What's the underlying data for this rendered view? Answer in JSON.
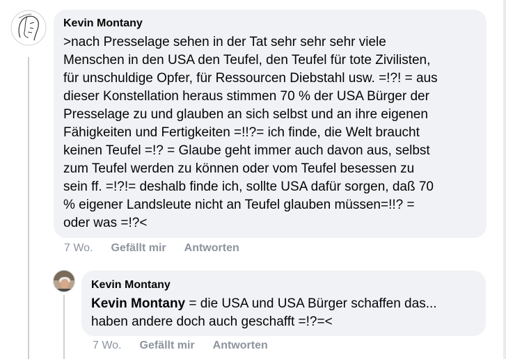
{
  "comments": [
    {
      "author": "Kevin Montany",
      "avatar_icon": "sketch-face-avatar-icon",
      "text_lines": [
        ">nach Presselage sehen in der Tat sehr sehr sehr viele",
        "Menschen in den USA den Teufel, den Teufel für tote Zivilisten,",
        "für unschuldige Opfer, für Ressourcen Diebstahl usw. =!?! = aus",
        "dieser Konstellation heraus  stimmen  70 %  der USA Bürger der",
        "Presselage  zu und glauben an sich selbst und an ihre eigenen",
        "Fähigkeiten und Fertigkeiten =!!?= ich finde, die Welt braucht",
        "keinen Teufel =!? = Glaube geht immer auch davon aus, selbst",
        "zum Teufel werden zu können oder vom Teufel besessen zu",
        "sein ff. =!?!= deshalb finde ich,  sollte USA dafür sorgen, daß 70",
        "% eigener Landsleute nicht an Teufel glauben müssen=!!? =",
        "oder was =!?<"
      ],
      "time": "7 Wo.",
      "like_label": "Gefällt mir",
      "reply_label": "Antworten"
    },
    {
      "author": "Kevin Montany",
      "avatar_icon": "photo-avatar-icon",
      "mention": "Kevin Montany",
      "text_line1_rest": " = die USA und USA Bürger schaffen das...",
      "text_line2": "haben andere doch auch geschafft =!?=<",
      "time": "7 Wo.",
      "like_label": "Gefällt mir",
      "reply_label": "Antworten"
    }
  ]
}
